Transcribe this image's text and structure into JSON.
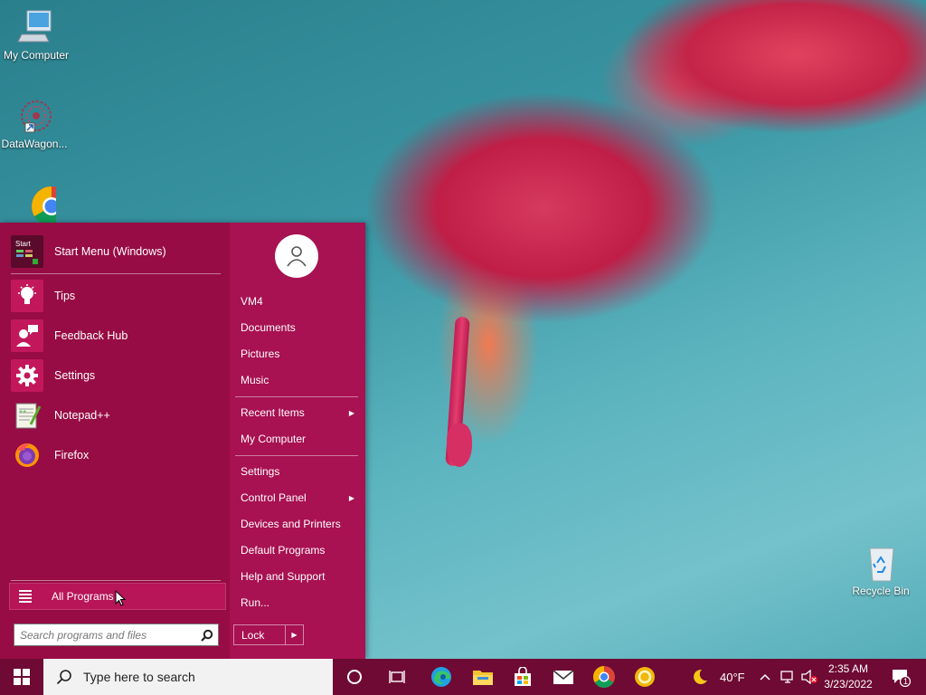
{
  "desktop": {
    "icons": [
      {
        "label": "My Computer"
      },
      {
        "label": "DataWagon..."
      },
      {
        "label": "Recycle Bin"
      }
    ]
  },
  "start_menu": {
    "programs": [
      {
        "label": "Start Menu (Windows)",
        "icon": "start-menu-app-icon"
      },
      {
        "label": "Tips",
        "icon": "lightbulb-icon"
      },
      {
        "label": "Feedback Hub",
        "icon": "feedback-hub-icon"
      },
      {
        "label": "Settings",
        "icon": "gear-icon"
      },
      {
        "label": "Notepad++",
        "icon": "notepad-plus-plus-icon"
      },
      {
        "label": "Firefox",
        "icon": "firefox-icon"
      }
    ],
    "all_programs_label": "All Programs",
    "search_placeholder": "Search programs and files",
    "right_items": [
      {
        "label": "VM4"
      },
      {
        "label": "Documents"
      },
      {
        "label": "Pictures"
      },
      {
        "label": "Music"
      },
      {
        "label": "Recent Items",
        "submenu": true
      },
      {
        "label": "My Computer"
      },
      {
        "label": "Settings"
      },
      {
        "label": "Control Panel",
        "submenu": true
      },
      {
        "label": "Devices and Printers"
      },
      {
        "label": "Default Programs"
      },
      {
        "label": "Help and Support"
      },
      {
        "label": "Run..."
      }
    ],
    "lock_label": "Lock",
    "colors": {
      "menu_bg": "#a30f4a",
      "left_bg": "#970c44",
      "accent": "#b81458"
    }
  },
  "taskbar": {
    "search_placeholder": "Type here to search",
    "pinned": [
      "cortana-icon",
      "task-view-icon",
      "edge-icon",
      "file-explorer-icon",
      "store-icon",
      "mail-icon",
      "chrome-icon",
      "yellow-circle-app-icon"
    ],
    "weather": {
      "temp": "40°F",
      "icon": "moon-icon"
    },
    "clock": {
      "time": "2:35 AM",
      "date": "3/23/2022"
    },
    "notification_count": "1",
    "color": "#6e0a33"
  }
}
